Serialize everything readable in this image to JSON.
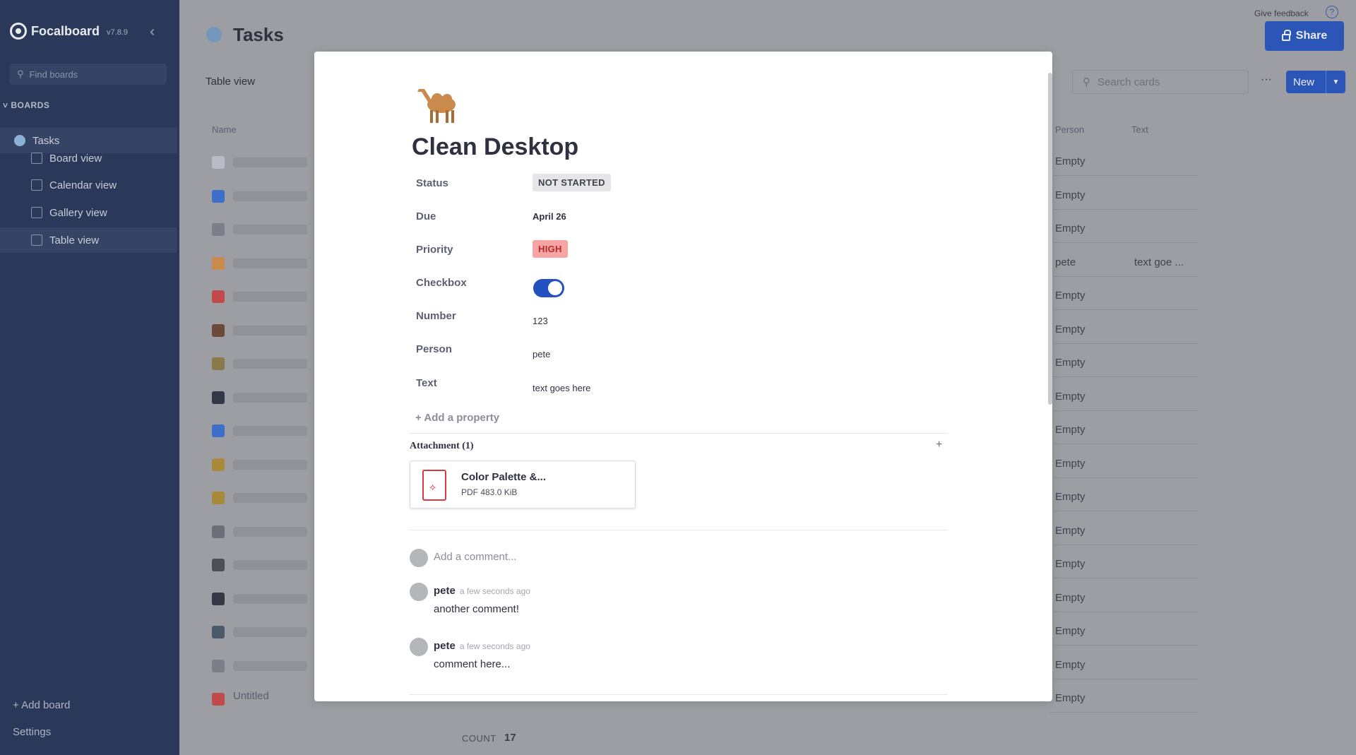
{
  "app": {
    "name": "Focalboard",
    "version": "v7.8.9"
  },
  "sidebar": {
    "find_placeholder": "Find boards",
    "boards_header": "BOARDS",
    "board_name": "Tasks",
    "views": [
      {
        "label": "Board view",
        "icon": "board-view-icon"
      },
      {
        "label": "Calendar view",
        "icon": "calendar-view-icon"
      },
      {
        "label": "Gallery view",
        "icon": "gallery-view-icon"
      },
      {
        "label": "Table view",
        "icon": "table-view-icon"
      }
    ],
    "add_board": "+ Add board",
    "settings": "Settings"
  },
  "header": {
    "title": "Tasks",
    "give_feedback": "Give feedback",
    "share_label": "Share",
    "view_label": "Table view",
    "search_placeholder": "Search cards",
    "more_label": "···",
    "new_label": "New"
  },
  "table": {
    "columns": {
      "name": "Name",
      "person": "Person",
      "text": "Text"
    },
    "last_row_name": "Untitled",
    "rows_person": [
      "Empty",
      "Empty",
      "Empty",
      "pete",
      "Empty",
      "Empty",
      "Empty",
      "Empty",
      "Empty",
      "Empty",
      "Empty",
      "Empty",
      "Empty",
      "Empty",
      "Empty",
      "Empty",
      "Empty"
    ],
    "row4_text": "text goe ...",
    "count_label": "COUNT",
    "count_value": "17"
  },
  "card": {
    "title": "Clean Desktop",
    "properties": {
      "status": {
        "label": "Status",
        "value": "NOT STARTED"
      },
      "due": {
        "label": "Due",
        "value": "April 26"
      },
      "priority": {
        "label": "Priority",
        "value": "HIGH"
      },
      "checkbox": {
        "label": "Checkbox",
        "checked": true
      },
      "number": {
        "label": "Number",
        "value": "123"
      },
      "person": {
        "label": "Person",
        "value": "pete"
      },
      "text": {
        "label": "Text",
        "value": "text goes here"
      }
    },
    "add_property": "+ Add a property",
    "attachment": {
      "title": "Attachment (1)",
      "add_label": "+",
      "file_name": "Color Palette &...",
      "file_meta": "PDF 483.0 KiB"
    },
    "comment_placeholder": "Add a comment...",
    "comments": [
      {
        "author": "pete",
        "time": "a few seconds ago",
        "text": "another comment!"
      },
      {
        "author": "pete",
        "time": "a few seconds ago",
        "text": "comment here..."
      }
    ]
  },
  "colors": {
    "sidebar_bg": "#2a3959",
    "accent": "#2c55b8",
    "toggle_on": "#2451c2",
    "priority_high_bg": "#f6a4a4"
  }
}
